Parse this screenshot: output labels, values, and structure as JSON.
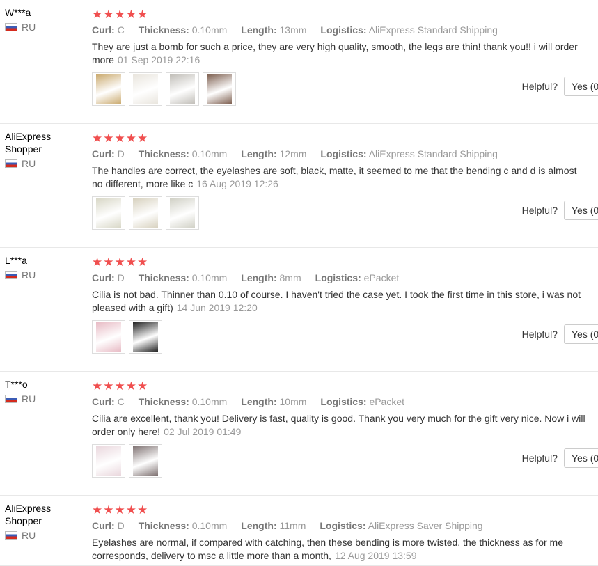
{
  "helpful_label": "Helpful?",
  "yes_label": "Yes (0",
  "star_glyph": "★",
  "star_color": "#f04f4f",
  "reviews": [
    {
      "name": "W***a",
      "country": "RU",
      "rating": 5,
      "attributes": [
        {
          "key": "Curl:",
          "value": "C"
        },
        {
          "key": "Thickness:",
          "value": "0.10mm"
        },
        {
          "key": "Length:",
          "value": "13mm"
        },
        {
          "key": "Logistics:",
          "value": "AliExpress Standard Shipping"
        }
      ],
      "text": "They are just a bomb for such a price, they are very high quality, smooth, the legs are thin! thank you!! i will order more",
      "date": "01 Sep 2019 22:16",
      "photos": 4
    },
    {
      "name": "AliExpress Shopper",
      "country": "RU",
      "rating": 5,
      "attributes": [
        {
          "key": "Curl:",
          "value": "D"
        },
        {
          "key": "Thickness:",
          "value": "0.10mm"
        },
        {
          "key": "Length:",
          "value": "12mm"
        },
        {
          "key": "Logistics:",
          "value": "AliExpress Standard Shipping"
        }
      ],
      "text": "The handles are correct, the eyelashes are soft, black, matte, it seemed to me that the bending c and d is almost no different, more like c",
      "date": "16 Aug 2019 12:26",
      "photos": 3
    },
    {
      "name": "L***a",
      "country": "RU",
      "rating": 5,
      "attributes": [
        {
          "key": "Curl:",
          "value": "D"
        },
        {
          "key": "Thickness:",
          "value": "0.10mm"
        },
        {
          "key": "Length:",
          "value": "8mm"
        },
        {
          "key": "Logistics:",
          "value": "ePacket"
        }
      ],
      "text": "Cilia is not bad. Thinner than 0.10 of course. I haven't tried the case yet. I took the first time in this store, i was not pleased with a gift)",
      "date": "14 Jun 2019 12:20",
      "photos": 2
    },
    {
      "name": "T***o",
      "country": "RU",
      "rating": 5,
      "attributes": [
        {
          "key": "Curl:",
          "value": "C"
        },
        {
          "key": "Thickness:",
          "value": "0.10mm"
        },
        {
          "key": "Length:",
          "value": "10mm"
        },
        {
          "key": "Logistics:",
          "value": "ePacket"
        }
      ],
      "text": "Cilia are excellent, thank you! Delivery is fast, quality is good. Thank you very much for the gift very nice. Now i will order only here!",
      "date": "02 Jul 2019 01:49",
      "photos": 2
    },
    {
      "name": "AliExpress Shopper",
      "country": "RU",
      "rating": 5,
      "attributes": [
        {
          "key": "Curl:",
          "value": "D"
        },
        {
          "key": "Thickness:",
          "value": "0.10mm"
        },
        {
          "key": "Length:",
          "value": "11mm"
        },
        {
          "key": "Logistics:",
          "value": "AliExpress Saver Shipping"
        }
      ],
      "text": "Eyelashes are normal, if compared with catching, then these bending is more twisted, the thickness as for me corresponds, delivery to msc a little more than a month,",
      "date": "12 Aug 2019 13:59",
      "photos": 0
    }
  ]
}
